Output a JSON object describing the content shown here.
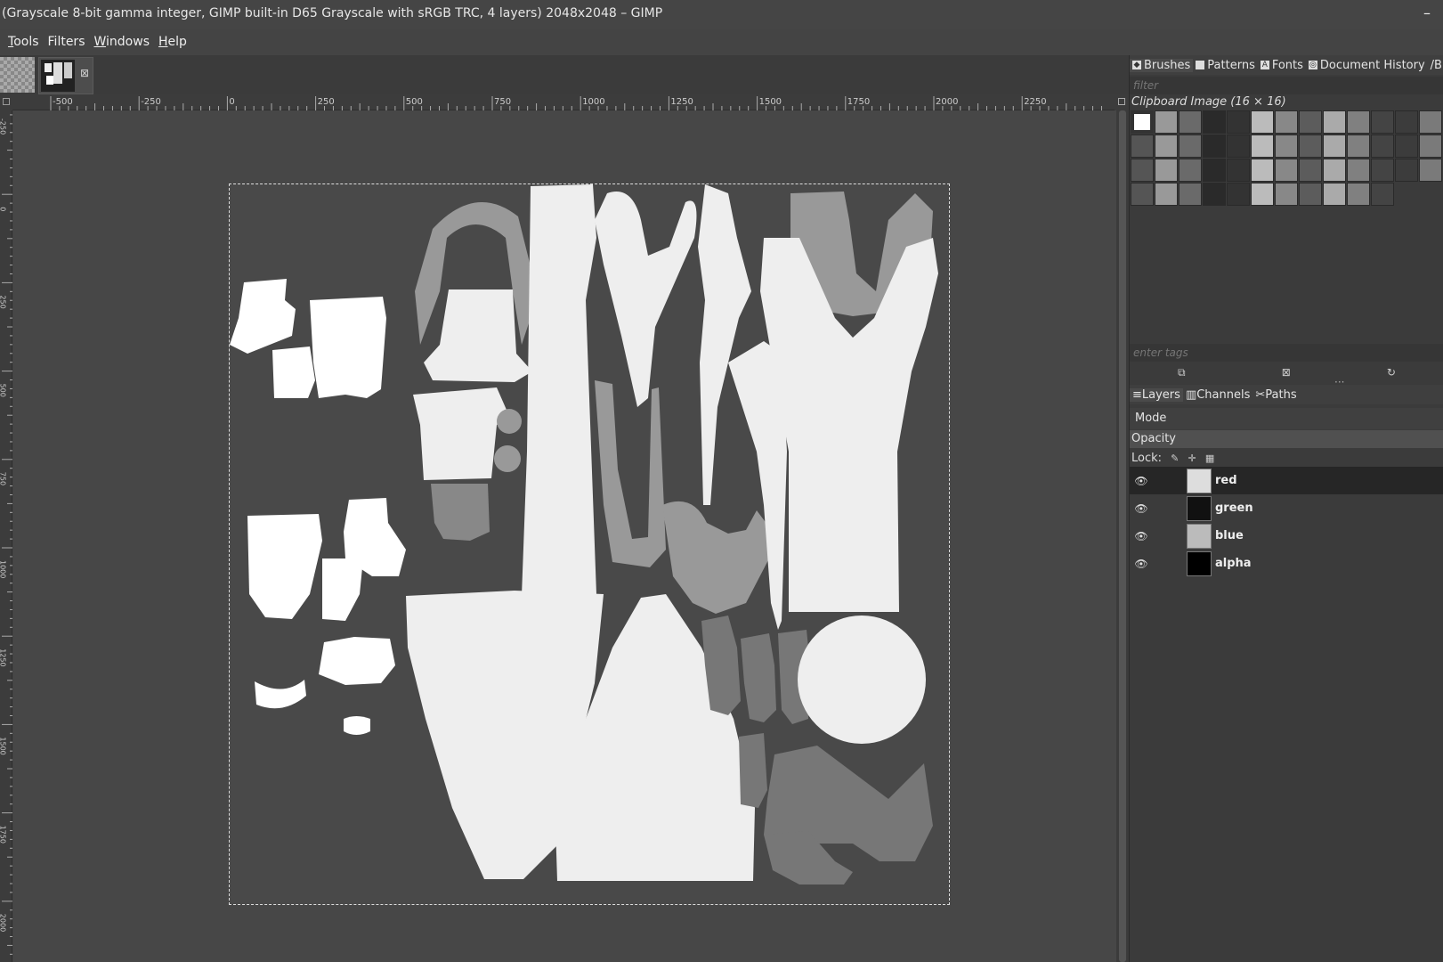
{
  "window": {
    "title": "(Grayscale 8-bit gamma integer, GIMP built-in D65 Grayscale with sRGB TRC, 4 layers) 2048x2048 – GIMP",
    "minimize_glyph": "–"
  },
  "menu": [
    {
      "label": "Tools",
      "mnemonic": "T",
      "rest": "ools"
    },
    {
      "label": "Filters",
      "mnemonic": "",
      "rest": "Filters"
    },
    {
      "label": "Windows",
      "mnemonic": "W",
      "rest": "indows"
    },
    {
      "label": "Help",
      "mnemonic": "H",
      "rest": "elp"
    }
  ],
  "image_tabs": {
    "close_glyph": "⊠"
  },
  "hruler_labels": [
    "-500",
    "-250",
    "0",
    "250",
    "500",
    "750",
    "1000",
    "1250",
    "1500",
    "1750",
    "2000",
    "2250"
  ],
  "vruler_labels": [
    "-250",
    "0",
    "250",
    "500",
    "750",
    "1000",
    "1250",
    "1500",
    "1750",
    "2000"
  ],
  "brushes_dock": {
    "tabs": [
      "Brushes",
      "Patterns",
      "Fonts",
      "Document History",
      "Brush E"
    ],
    "filter_placeholder": "filter",
    "selected_brush": "Clipboard Image (16 × 16)",
    "tags_placeholder": "enter tags",
    "brush_count": 50
  },
  "layers_dock": {
    "tabs": [
      "Layers",
      "Channels",
      "Paths"
    ],
    "mode_label": "Mode",
    "opacity_label": "Opacity",
    "lock_label": "Lock:",
    "layers": [
      {
        "name": "red",
        "selected": true
      },
      {
        "name": "green",
        "selected": false
      },
      {
        "name": "blue",
        "selected": false
      },
      {
        "name": "alpha",
        "selected": false
      }
    ]
  }
}
